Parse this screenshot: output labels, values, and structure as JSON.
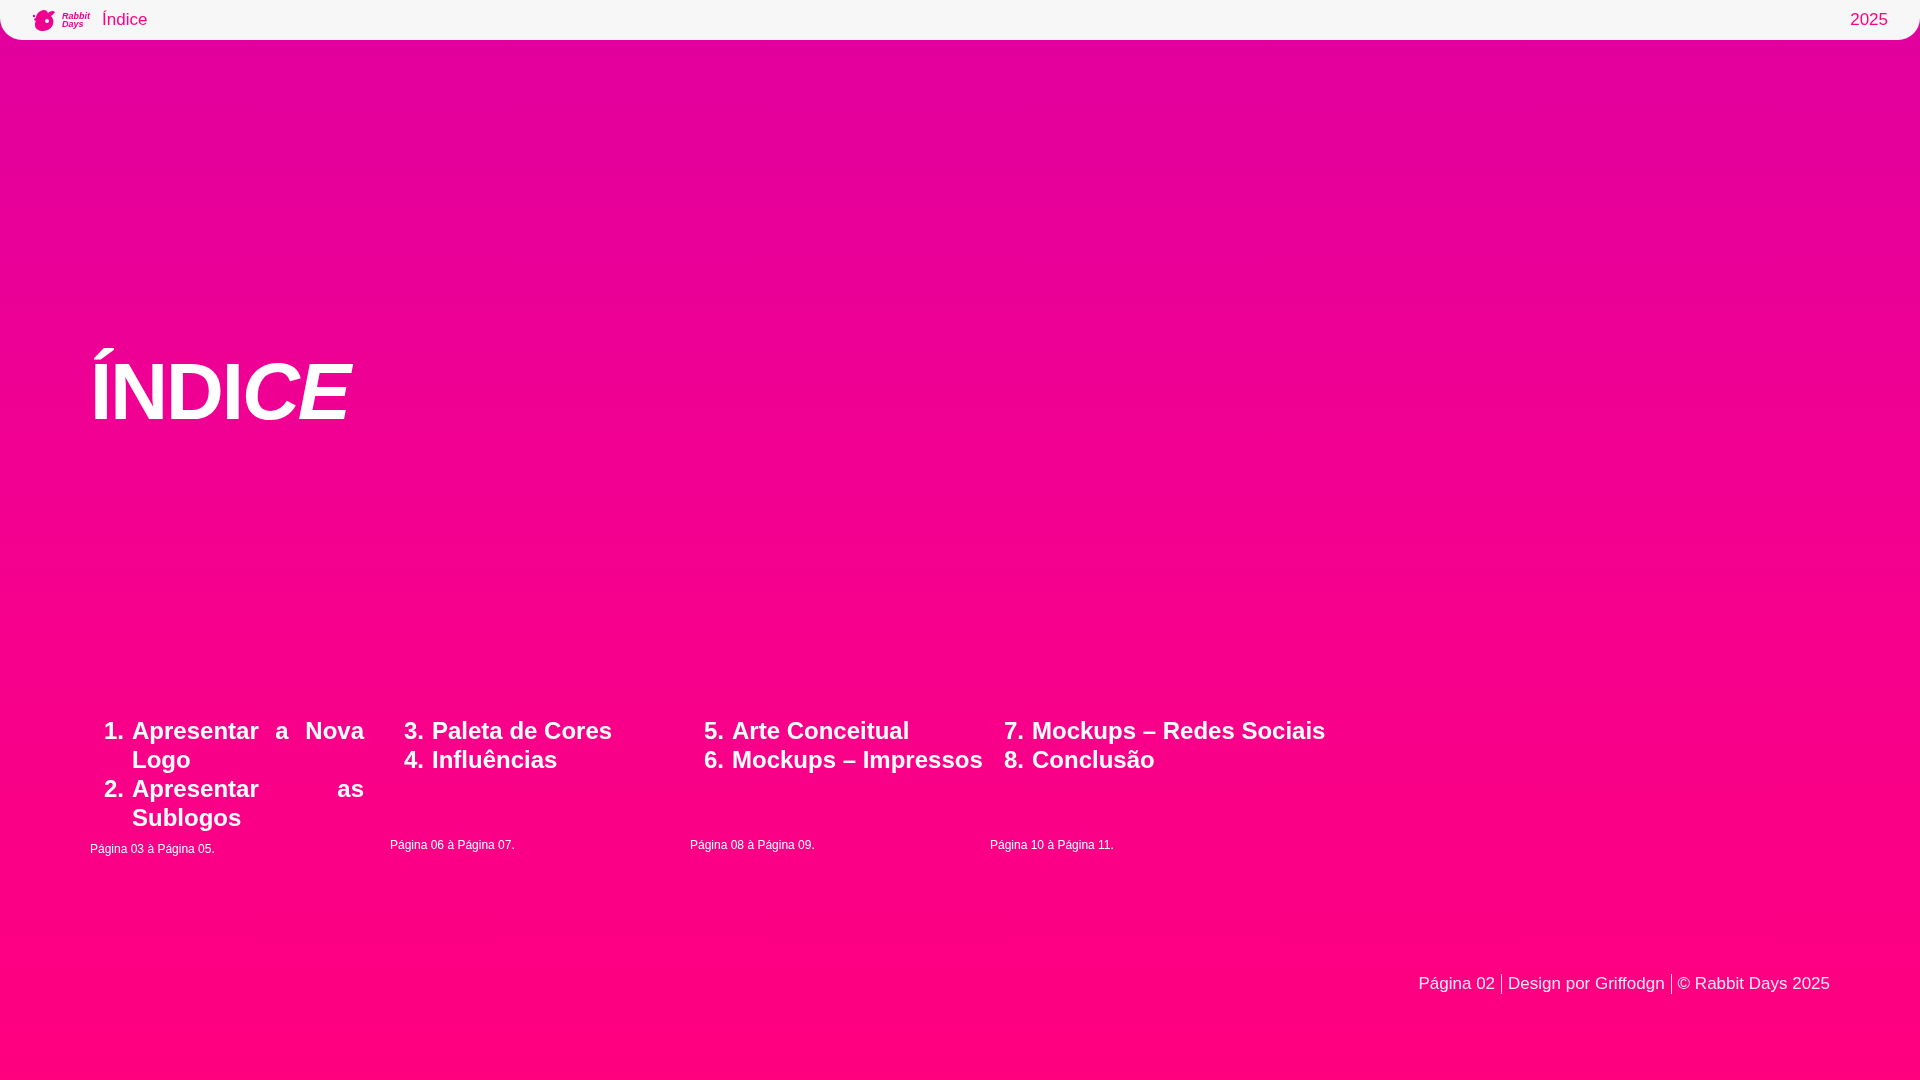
{
  "top_bar": {
    "logo_text": [
      "Rabbit",
      "Days"
    ],
    "title": "Índice",
    "year": "2025"
  },
  "heading": {
    "upright": "ÍNDI",
    "italic": "CE"
  },
  "sections": [
    {
      "items": [
        {
          "number": "1.",
          "text": "Apresentar a Nova Logo"
        },
        {
          "number": "2.",
          "text": "Apresentar as Sublogos"
        }
      ],
      "pages": "Página 03 à Página 05."
    },
    {
      "items": [
        {
          "number": "3.",
          "text": "Paleta de Cores"
        },
        {
          "number": "4.",
          "text": "Influências"
        }
      ],
      "pages": "Página 06 à Página 07."
    },
    {
      "items": [
        {
          "number": "5.",
          "text": "Arte Conceitual"
        },
        {
          "number": "6.",
          "text": "Mockups – Impressos"
        }
      ],
      "pages": "Página 08 à Página 09."
    },
    {
      "items": [
        {
          "number": "7.",
          "text": "Mockups – Redes Sociais"
        },
        {
          "number": "8.",
          "text": "Conclusão"
        }
      ],
      "pages": "Página 10 à Página 11."
    }
  ],
  "footer": [
    "Página 02",
    "Design por Griffodgn",
    "© Rabbit Days 2025"
  ]
}
